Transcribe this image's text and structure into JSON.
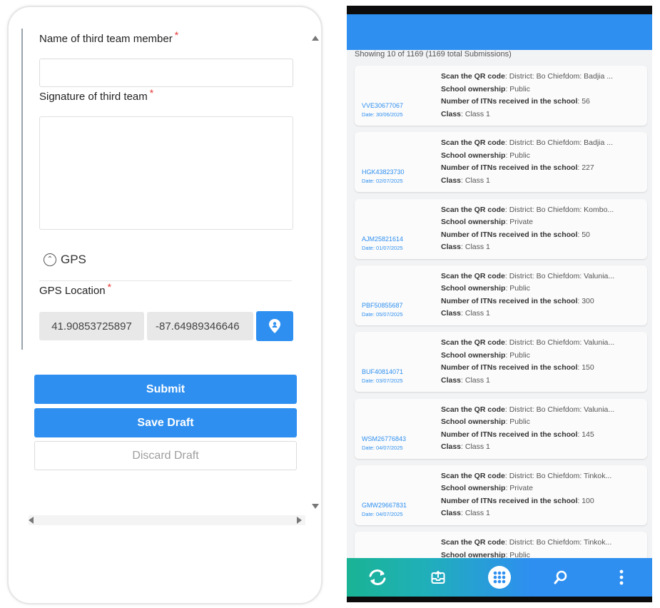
{
  "form": {
    "name_label": "Name of third team member",
    "name_value": "",
    "signature_label": "Signature of third team",
    "required_mark": "*",
    "gps_section_title": "GPS",
    "gps_location_label": "GPS Location",
    "latitude": "41.90853725897",
    "longitude": "-87.64989346646",
    "submit_label": "Submit",
    "save_draft_label": "Save Draft",
    "discard_draft_label": "Discard Draft"
  },
  "list": {
    "showing_text": "Showing 10 of 1169 (1169 total Submissions)",
    "field_labels": {
      "qr": "Scan the QR code",
      "ownership": "School ownership",
      "itns": "Number of ITNs received in the school",
      "class": "Class"
    },
    "cards": [
      {
        "id": "VVE30677067",
        "date": "Date: 30/06/2025",
        "qr": "District: Bo Chiefdom: Badjia ...",
        "ownership": "Public",
        "itns": "56",
        "class": "Class 1"
      },
      {
        "id": "HGK43823730",
        "date": "Date: 02/07/2025",
        "qr": "District: Bo Chiefdom: Badjia ...",
        "ownership": "Public",
        "itns": "227",
        "class": "Class 1"
      },
      {
        "id": "AJM25821614",
        "date": "Date: 01/07/2025",
        "qr": "District: Bo Chiefdom: Kombo...",
        "ownership": "Private",
        "itns": "50",
        "class": "Class 1"
      },
      {
        "id": "PBF50855687",
        "date": "Date: 05/07/2025",
        "qr": "District: Bo Chiefdom: Valunia...",
        "ownership": "Public",
        "itns": "300",
        "class": "Class 1"
      },
      {
        "id": "BUF40814071",
        "date": "Date: 03/07/2025",
        "qr": "District: Bo Chiefdom: Valunia...",
        "ownership": "Public",
        "itns": "150",
        "class": "Class 1"
      },
      {
        "id": "WSM26776843",
        "date": "Date: 04/07/2025",
        "qr": "District: Bo Chiefdom: Valunia...",
        "ownership": "Public",
        "itns": "145",
        "class": "Class 1"
      },
      {
        "id": "GMW29667831",
        "date": "Date: 04/07/2025",
        "qr": "District: Bo Chiefdom: Tinkok...",
        "ownership": "Private",
        "itns": "100",
        "class": "Class 1"
      },
      {
        "id": "",
        "date": "",
        "qr": "District: Bo Chiefdom: Tinkok...",
        "ownership": "Public",
        "itns": "",
        "class": ""
      }
    ]
  },
  "bottom_nav": [
    {
      "name": "sync-icon"
    },
    {
      "name": "inbox-upload-icon"
    },
    {
      "name": "apps-grid-icon"
    },
    {
      "name": "search-icon"
    },
    {
      "name": "more-vertical-icon"
    }
  ],
  "colors": {
    "primary": "#2e8ff0",
    "required": "#e53935",
    "nav_gradient_start": "#1ab394"
  }
}
